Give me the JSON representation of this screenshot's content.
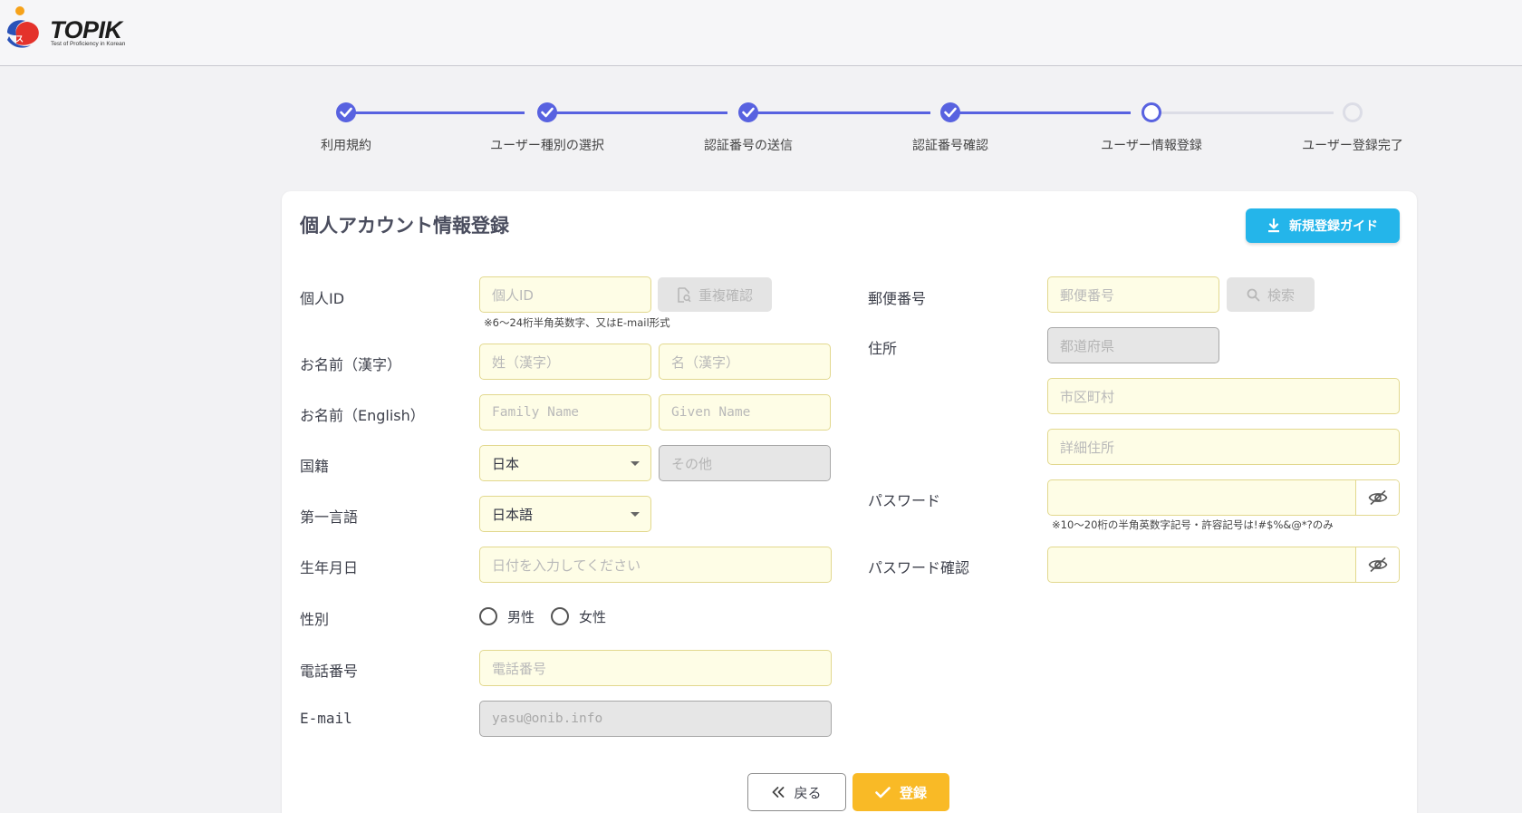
{
  "header": {
    "logo_text": "TOPIK",
    "logo_sub": "Test of Proficiency in Korean"
  },
  "stepper": {
    "steps": [
      {
        "label": "利用規約",
        "state": "done"
      },
      {
        "label": "ユーザー種別の選択",
        "state": "done"
      },
      {
        "label": "認証番号の送信",
        "state": "done"
      },
      {
        "label": "認証番号確認",
        "state": "done"
      },
      {
        "label": "ユーザー情報登録",
        "state": "current"
      },
      {
        "label": "ユーザー登録完了",
        "state": "todo"
      }
    ],
    "accent_color": "#5862e0"
  },
  "form": {
    "title": "個人アカウント情報登録",
    "guide_button": "新規登録ガイド",
    "id": {
      "label": "個人ID",
      "placeholder": "個人ID",
      "check_button": "重複確認",
      "hint": "※6～24桁半角英数字、又はE-mail形式"
    },
    "name_kanji": {
      "label": "お名前（漢字）",
      "last_placeholder": "姓（漢字）",
      "first_placeholder": "名（漢字）"
    },
    "name_english": {
      "label": "お名前（English）",
      "last_placeholder": "Family Name",
      "first_placeholder": "Given Name"
    },
    "nationality": {
      "label": "国籍",
      "value": "日本",
      "other_placeholder": "その他"
    },
    "language": {
      "label": "第一言語",
      "value": "日本語"
    },
    "birthdate": {
      "label": "生年月日",
      "placeholder": "日付を入力してください"
    },
    "gender": {
      "label": "性別",
      "options": [
        "男性",
        "女性"
      ]
    },
    "phone": {
      "label": "電話番号",
      "placeholder": "電話番号"
    },
    "email": {
      "label": "E-mail",
      "value": "yasu@onib.info"
    },
    "postal": {
      "label": "郵便番号",
      "placeholder": "郵便番号",
      "search_button": "検索"
    },
    "address": {
      "label": "住所",
      "prefecture_placeholder": "都道府県",
      "city_placeholder": "市区町村",
      "detail_placeholder": "詳細住所"
    },
    "password": {
      "label": "パスワード",
      "hint": "※10～20桁の半角英数字記号・許容記号は!#$%&@*?のみ"
    },
    "password_confirm": {
      "label": "パスワード確認"
    },
    "back_button": "戻る",
    "submit_button": "登録"
  },
  "icons": [
    "check-icon",
    "download-icon",
    "document-search-icon",
    "search-icon",
    "eye-off-icon",
    "double-chevron-left-icon"
  ],
  "colors": {
    "guide_button": "#24b5ea",
    "submit_button": "#f9ba26",
    "field_bg": "#fefde6"
  }
}
